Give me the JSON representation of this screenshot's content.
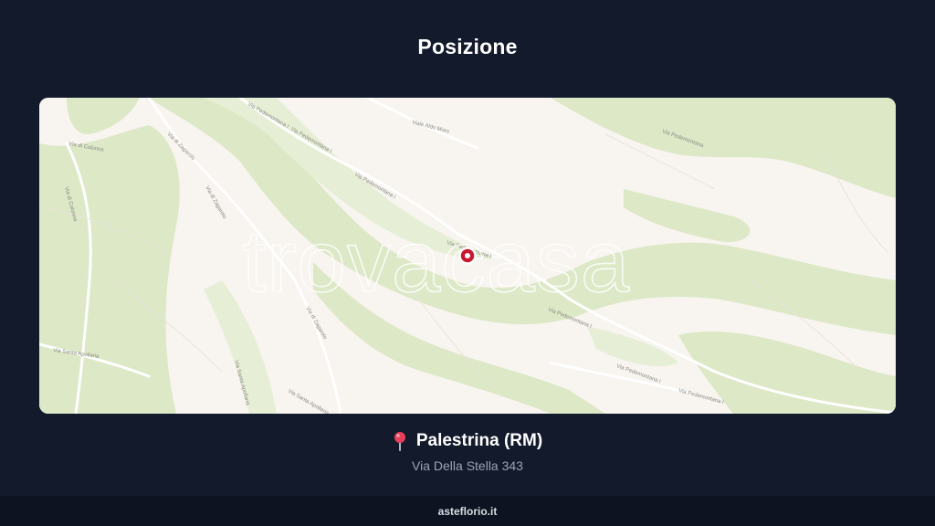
{
  "page": {
    "title": "Posizione",
    "footer_site": "asteflorio.it"
  },
  "map": {
    "watermark": "trovacasa",
    "colors": {
      "background": "#f8f4ef",
      "vegetation": "#dce8c6",
      "marker": "#c8192e"
    },
    "street_labels": [
      "Via Pedemontana I",
      "Via Pedemontana I",
      "Via Pedemontana I",
      "Via Pedemontana I",
      "Via Pedemontana I",
      "Via Pedemontana I",
      "Via Pedemontana I",
      "Via di Zagarolo",
      "Via di Zagarolo",
      "Via di Zagarolo",
      "Via di Colonna",
      "Via di Colonna",
      "Via Santa Apollaria",
      "Via Santa Apollaria",
      "Via Santa Apollaria",
      "Viale Aldo Moro",
      "Via Pedemontana"
    ]
  },
  "location": {
    "city": "Palestrina (RM)",
    "address": "Via Della Stella 343",
    "pin_icon": "map-pin-icon"
  }
}
